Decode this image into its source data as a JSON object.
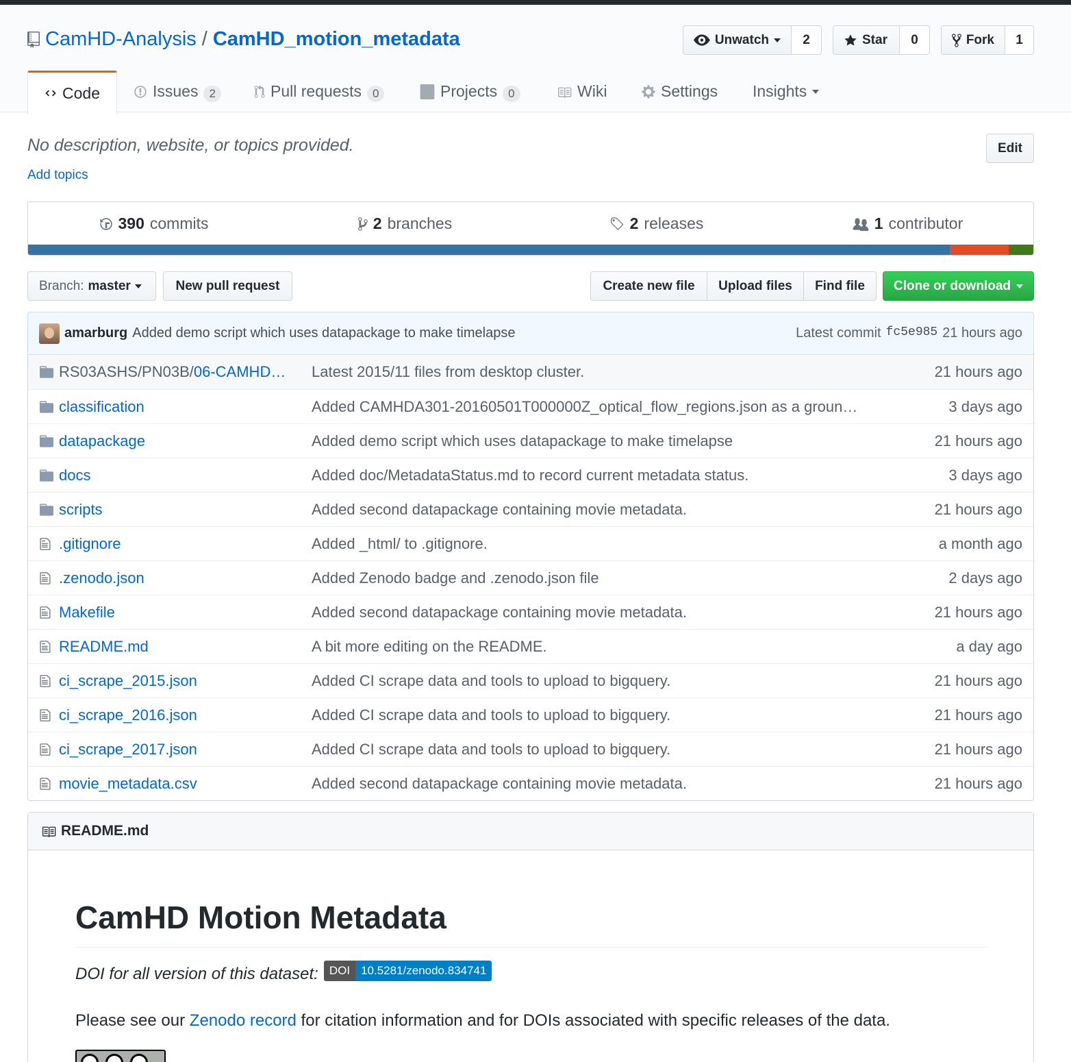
{
  "repo": {
    "owner": "CamHD-Analysis",
    "separator": "/",
    "name": "CamHD_motion_metadata"
  },
  "actions": {
    "watch_label": "Unwatch",
    "watch_count": "2",
    "star_label": "Star",
    "star_count": "0",
    "fork_label": "Fork",
    "fork_count": "1"
  },
  "tabs": [
    {
      "label": "Code",
      "icon": "code-icon"
    },
    {
      "label": "Issues",
      "count": "2",
      "icon": "issue-icon"
    },
    {
      "label": "Pull requests",
      "count": "0",
      "icon": "pull-request-icon"
    },
    {
      "label": "Projects",
      "count": "0",
      "icon": "project-icon"
    },
    {
      "label": "Wiki",
      "icon": "book-icon"
    },
    {
      "label": "Settings",
      "icon": "gear-icon"
    },
    {
      "label": "Insights",
      "icon": "chevron-down-icon"
    }
  ],
  "description": {
    "text": "No description, website, or topics provided.",
    "add_topics": "Add topics",
    "edit_label": "Edit"
  },
  "summary": {
    "commits_num": "390",
    "commits_label": "commits",
    "branches_num": "2",
    "branches_label": "branches",
    "releases_num": "2",
    "releases_label": "releases",
    "contributors_num": "1",
    "contributors_label": "contributor"
  },
  "language_colors": {
    "primary": "#3572A5",
    "secondary": "#e44b23",
    "tertiary": "#427819"
  },
  "toolbar": {
    "branch_label": "Branch:",
    "branch_value": "master",
    "new_pr": "New pull request",
    "create_file": "Create new file",
    "upload_files": "Upload files",
    "find_file": "Find file",
    "clone": "Clone or download"
  },
  "latest_commit": {
    "author": "amarburg",
    "message": "Added demo script which uses datapackage to make timelapse",
    "label": "Latest commit",
    "sha": "fc5e985",
    "age": "21 hours ago"
  },
  "files": [
    {
      "type": "dir",
      "path_prefix": "RS03ASHS/PN03B/",
      "name": "06-CAMHD…",
      "message": "Latest 2015/11 files from desktop cluster.",
      "age": "21 hours ago"
    },
    {
      "type": "dir",
      "name": "classification",
      "message": "Added CAMHDA301-20160501T000000Z_optical_flow_regions.json as a groun…",
      "age": "3 days ago"
    },
    {
      "type": "dir",
      "name": "datapackage",
      "message": "Added demo script which uses datapackage to make timelapse",
      "age": "21 hours ago"
    },
    {
      "type": "dir",
      "name": "docs",
      "message": "Added doc/MetadataStatus.md to record current metadata status.",
      "age": "3 days ago"
    },
    {
      "type": "dir",
      "name": "scripts",
      "message": "Added second datapackage containing movie metadata.",
      "age": "21 hours ago"
    },
    {
      "type": "file",
      "name": ".gitignore",
      "message": "Added _html/ to .gitignore.",
      "age": "a month ago"
    },
    {
      "type": "file",
      "name": ".zenodo.json",
      "message": "Added Zenodo badge and .zenodo.json file",
      "age": "2 days ago"
    },
    {
      "type": "file",
      "name": "Makefile",
      "message": "Added second datapackage containing movie metadata.",
      "age": "21 hours ago"
    },
    {
      "type": "file",
      "name": "README.md",
      "message": "A bit more editing on the README.",
      "age": "a day ago"
    },
    {
      "type": "file",
      "name": "ci_scrape_2015.json",
      "message": "Added CI scrape data and tools to upload to bigquery.",
      "age": "21 hours ago"
    },
    {
      "type": "file",
      "name": "ci_scrape_2016.json",
      "message": "Added CI scrape data and tools to upload to bigquery.",
      "age": "21 hours ago"
    },
    {
      "type": "file",
      "name": "ci_scrape_2017.json",
      "message": "Added CI scrape data and tools to upload to bigquery.",
      "age": "21 hours ago"
    },
    {
      "type": "file",
      "name": "movie_metadata.csv",
      "message": "Added second datapackage containing movie metadata.",
      "age": "21 hours ago"
    }
  ],
  "readme": {
    "filename": "README.md",
    "heading": "CamHD Motion Metadata",
    "doi_text": "DOI for all version of this dataset:",
    "doi_badge_label": "DOI",
    "doi_badge_value": "10.5281/zenodo.834741",
    "para_before": "Please see our",
    "para_link": "Zenodo record",
    "para_after": "for citation information and for DOIs associated with specific releases of the data."
  }
}
